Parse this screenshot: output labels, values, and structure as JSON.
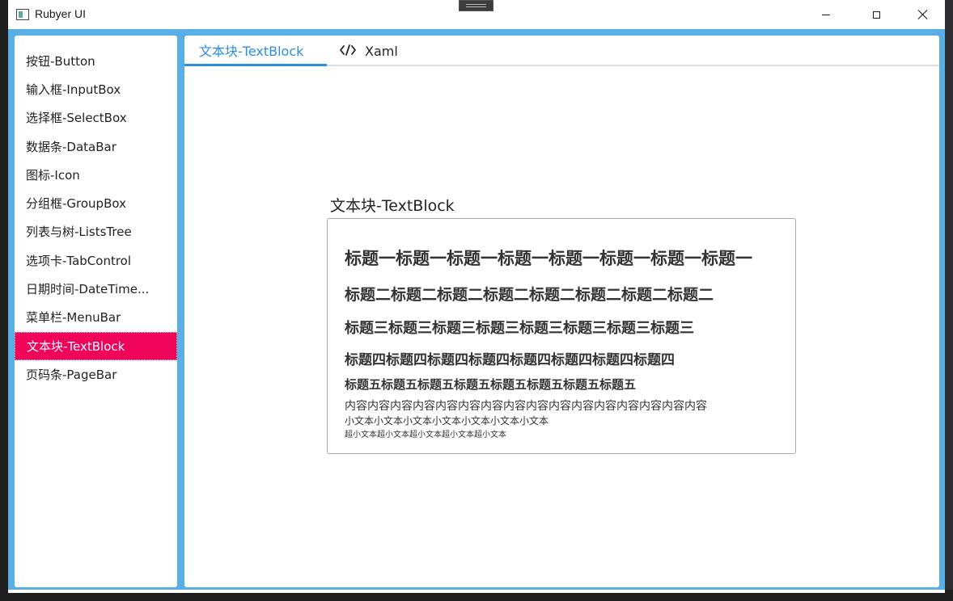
{
  "window": {
    "title": "Rubyer UI"
  },
  "sidebar": {
    "items": [
      {
        "label": "按钮-Button"
      },
      {
        "label": "输入框-InputBox"
      },
      {
        "label": "选择框-SelectBox"
      },
      {
        "label": "数据条-DataBar"
      },
      {
        "label": "图标-Icon"
      },
      {
        "label": "分组框-GroupBox"
      },
      {
        "label": "列表与树-ListsTree"
      },
      {
        "label": "选项卡-TabControl"
      },
      {
        "label": "日期时间-DateTime..."
      },
      {
        "label": "菜单栏-MenuBar"
      },
      {
        "label": "文本块-TextBlock"
      },
      {
        "label": "页码条-PageBar"
      }
    ],
    "active_index": 10,
    "active_color": "#f0045a"
  },
  "tabs": [
    {
      "label": "文本块-TextBlock"
    },
    {
      "label": "Xaml",
      "icon": "code-icon"
    }
  ],
  "accent_color": "#2a8fe0",
  "main": {
    "group_title": "文本块-TextBlock",
    "texts": {
      "h1": "标题一标题一标题一标题一标题一标题一标题一标题一",
      "h2": "标题二标题二标题二标题二标题二标题二标题二标题二",
      "h3": "标题三标题三标题三标题三标题三标题三标题三标题三",
      "h4": "标题四标题四标题四标题四标题四标题四标题四标题四",
      "h5": "标题五标题五标题五标题五标题五标题五标题五标题五",
      "p": "内容内容内容内容内容内容内容内容内容内容内容内容内容内容内容内容",
      "small": "小文本小文本小文本小文本小文本小文本小文本",
      "xsmall": "超小文本超小文本超小文本超小文本超小文本"
    }
  }
}
